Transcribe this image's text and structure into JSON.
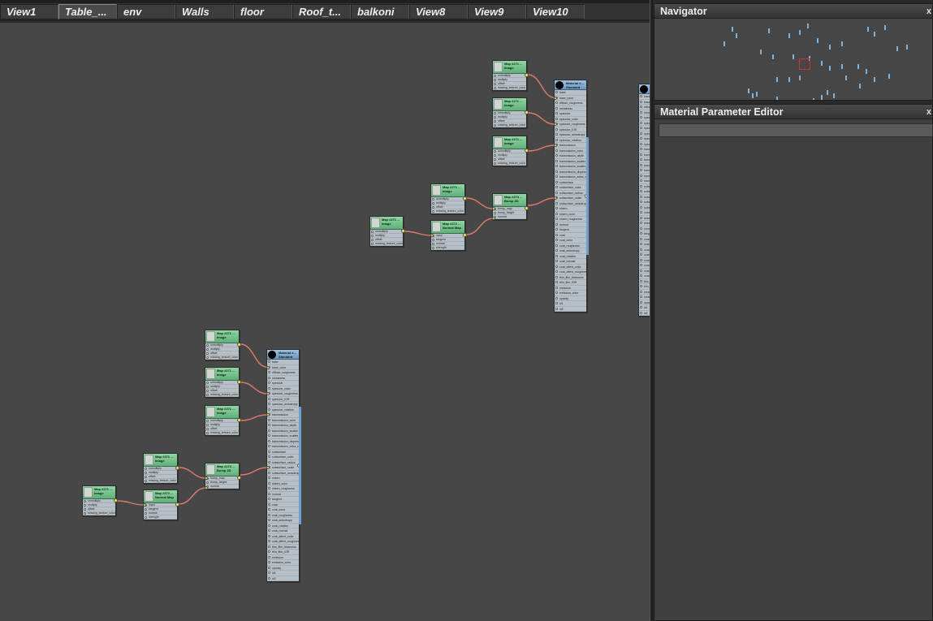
{
  "tabs": [
    "View1",
    "Table_...",
    "env",
    "Walls",
    "floor",
    "Roof_t...",
    "balkoni",
    "View8",
    "View9",
    "View10"
  ],
  "active_tab": 1,
  "navigator": {
    "title": "Navigator",
    "close": "x"
  },
  "parameter_editor": {
    "title": "Material Parameter Editor",
    "close": "x"
  },
  "node_types": {
    "image": {
      "title": [
        "Map #271 ...",
        "Image"
      ],
      "ports": [
        "unmultiply",
        "multiply",
        "offset",
        "missing_texture_color"
      ]
    },
    "normal": {
      "title": [
        "Map #272 ...",
        "Normal Map"
      ],
      "ports": [
        "input",
        "tangent",
        "normal",
        "strength"
      ]
    },
    "bump": {
      "title": [
        "Map #273 ...",
        "Bump 2D"
      ],
      "ports": [
        "bump_map",
        "bump_height",
        "normal"
      ]
    },
    "material": {
      "title": [
        "Material #...",
        "Standard"
      ],
      "ports": [
        "base",
        "base_color",
        "diffuse_roughness",
        "metalness",
        "specular",
        "specular_color",
        "specular_roughness",
        "specular_IOR",
        "specular_anisotropy",
        "specular_rotation",
        "transmission",
        "transmission_color",
        "transmission_depth",
        "transmission_scatter",
        "transmission_scatter_aniso",
        "transmission_dispersion",
        "transmission_extra_roughness",
        "subsurface",
        "subsurface_color",
        "subsurface_radius",
        "subsurface_scale",
        "subsurface_anisotropy",
        "sheen",
        "sheen_color",
        "sheen_roughness",
        "normal",
        "tangent",
        "coat",
        "coat_color",
        "coat_roughness",
        "coat_anisotropy",
        "coat_rotation",
        "coat_normal",
        "coat_affect_color",
        "coat_affect_roughness",
        "thin_film_thickness",
        "thin_film_IOR",
        "emission",
        "emission_color",
        "opacity",
        "id1",
        "id2"
      ]
    }
  },
  "colors": {
    "canvas": "#474747",
    "map_header": "#6fbf88",
    "material_header": "#7ba3c9",
    "wire": "#e07a6a",
    "output": "#e8f04a"
  }
}
